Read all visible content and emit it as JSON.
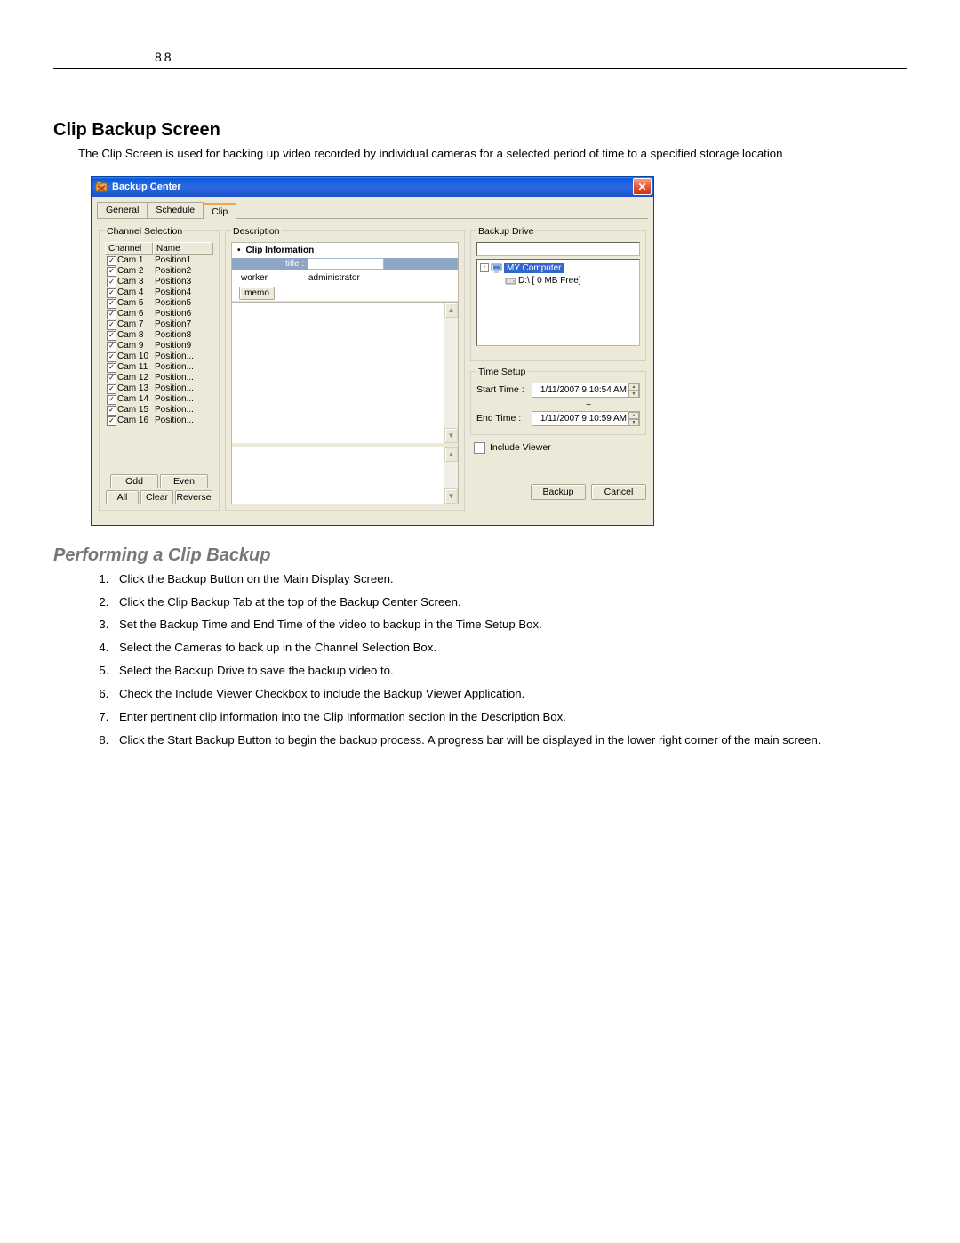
{
  "page_number": "88",
  "heading1": "Clip Backup Screen",
  "intro": "The Clip Screen is used for backing up video recorded by individual cameras for a selected period of time to a specified storage location",
  "heading2": "Performing a Clip Backup",
  "steps": [
    "Click the Backup Button on the Main Display Screen.",
    "Click the Clip Backup Tab at the top of the Backup Center Screen.",
    "Set the Backup Time and End Time of the video to backup in the Time Setup Box.",
    "Select the Cameras to back up in the Channel Selection Box.",
    "Select the Backup Drive to save the backup video to.",
    "Check the Include Viewer Checkbox to include the Backup Viewer Application.",
    "Enter pertinent clip information into the Clip Information section in the Description Box.",
    "Click the Start Backup Button to begin the backup process. A progress bar will be displayed in the lower right corner of the main screen."
  ],
  "window": {
    "title": "Backup Center",
    "tabs": {
      "general": "General",
      "schedule": "Schedule",
      "clip": "Clip"
    },
    "channel": {
      "legend": "Channel Selection",
      "head_channel": "Channel",
      "head_name": "Name",
      "rows": [
        {
          "cam": "Cam 1",
          "pos": "Position1"
        },
        {
          "cam": "Cam 2",
          "pos": "Position2"
        },
        {
          "cam": "Cam 3",
          "pos": "Position3"
        },
        {
          "cam": "Cam 4",
          "pos": "Position4"
        },
        {
          "cam": "Cam 5",
          "pos": "Position5"
        },
        {
          "cam": "Cam 6",
          "pos": "Position6"
        },
        {
          "cam": "Cam 7",
          "pos": "Position7"
        },
        {
          "cam": "Cam 8",
          "pos": "Position8"
        },
        {
          "cam": "Cam 9",
          "pos": "Position9"
        },
        {
          "cam": "Cam 10",
          "pos": "Position..."
        },
        {
          "cam": "Cam 11",
          "pos": "Position..."
        },
        {
          "cam": "Cam 12",
          "pos": "Position..."
        },
        {
          "cam": "Cam 13",
          "pos": "Position..."
        },
        {
          "cam": "Cam 14",
          "pos": "Position..."
        },
        {
          "cam": "Cam 15",
          "pos": "Position..."
        },
        {
          "cam": "Cam 16",
          "pos": "Position..."
        }
      ],
      "btn_odd": "Odd",
      "btn_even": "Even",
      "btn_all": "All",
      "btn_clear": "Clear",
      "btn_reverse": "Reverse"
    },
    "desc": {
      "legend": "Description",
      "clip_info": "Clip Information",
      "title_label": "title :",
      "worker_label": "worker",
      "worker_value": "administrator",
      "memo_btn": "memo"
    },
    "drive": {
      "legend": "Backup Drive",
      "mycomputer": "MY Computer",
      "d_drive": "D:\\ [ 0 MB Free]"
    },
    "time": {
      "legend": "Time Setup",
      "start_label": "Start Time :",
      "end_label": "End Time :",
      "start_value": "1/11/2007   9:10:54 AM",
      "end_value": "1/11/2007   9:10:59 AM",
      "tilde": "~"
    },
    "include_viewer": "Include Viewer",
    "btn_backup": "Backup",
    "btn_cancel": "Cancel"
  }
}
